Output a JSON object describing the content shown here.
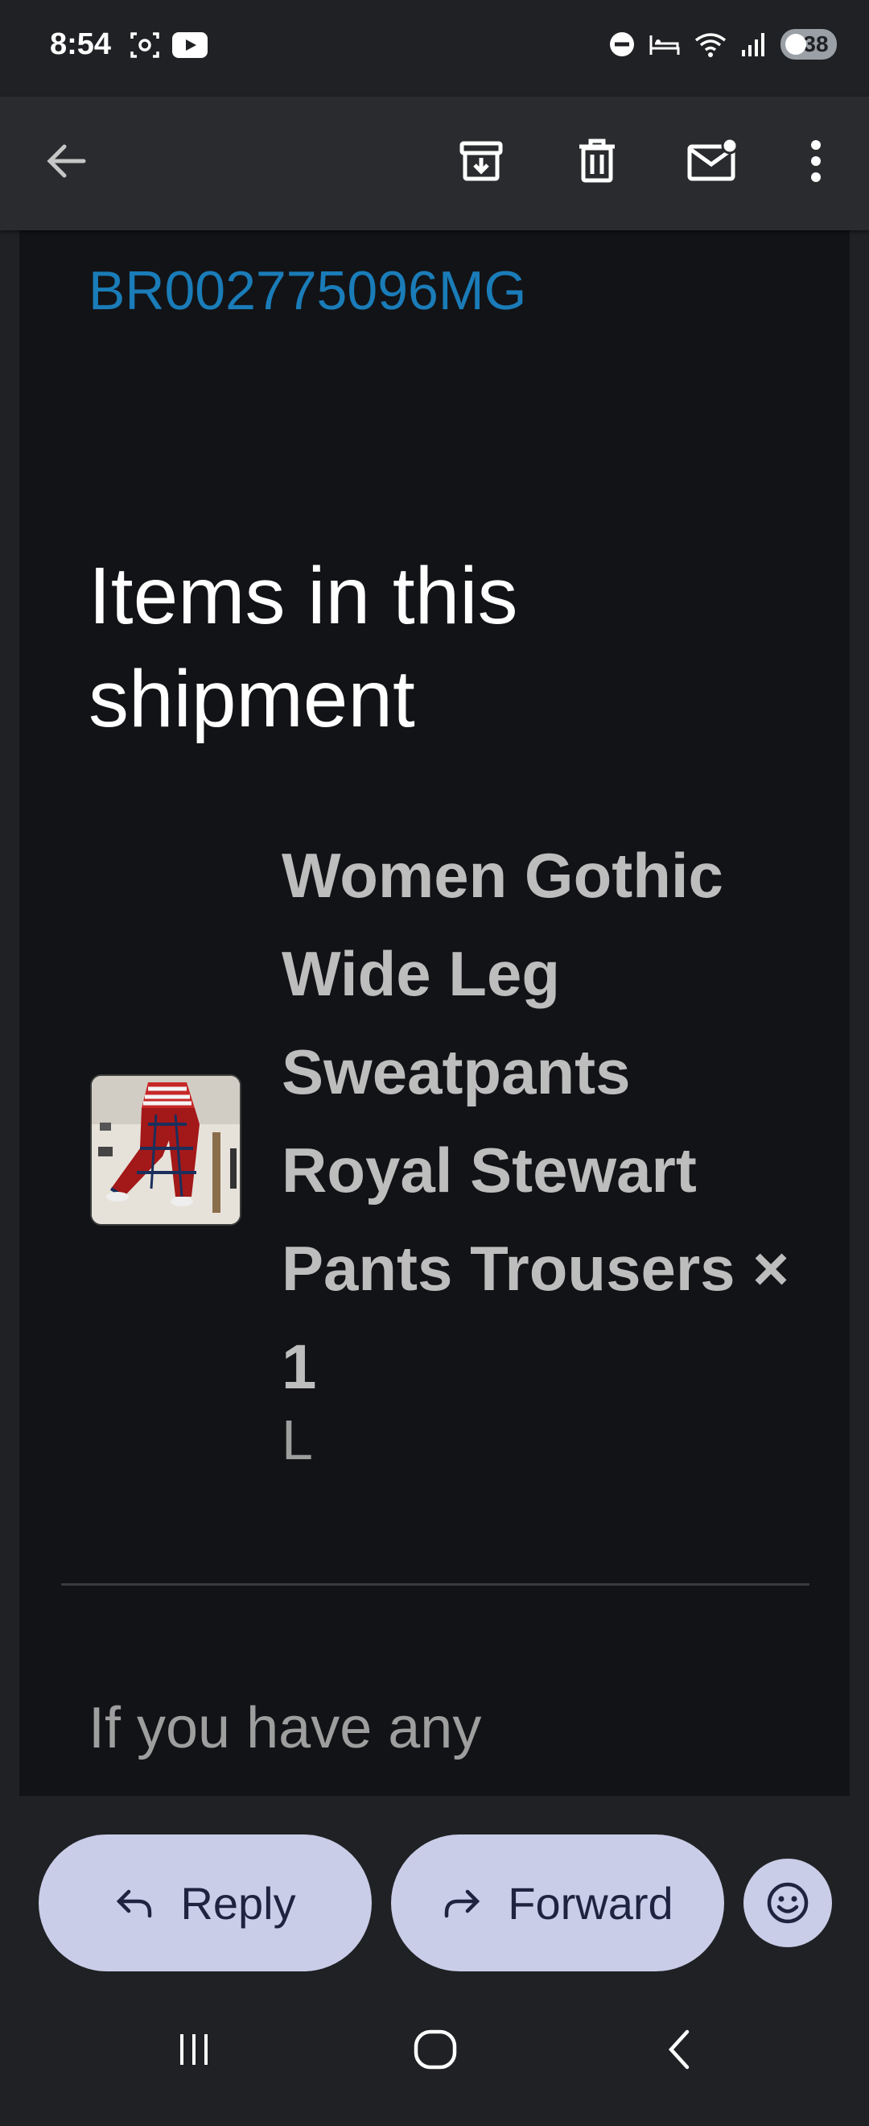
{
  "status_bar": {
    "time": "8:54",
    "battery": "38"
  },
  "toolbar": {
    "back_icon": "arrow-left-icon",
    "archive_icon": "archive-icon",
    "delete_icon": "trash-icon",
    "mark_unread_icon": "mail-unread-icon",
    "more_icon": "more-vert-icon"
  },
  "email": {
    "tracking_number": "BR002775096MG",
    "section_title": "Items in this shipment",
    "product": {
      "name": "Women Gothic Wide Leg Sweatpants Royal Stewart Pants Trousers × 1",
      "variant": "L"
    },
    "footer_text": "If you have any"
  },
  "actions": {
    "reply_label": "Reply",
    "forward_label": "Forward",
    "emoji_icon": "emoji-icon"
  },
  "colors": {
    "link": "#1a7cb8",
    "pill": "#c9cde8",
    "background": "#121316"
  }
}
